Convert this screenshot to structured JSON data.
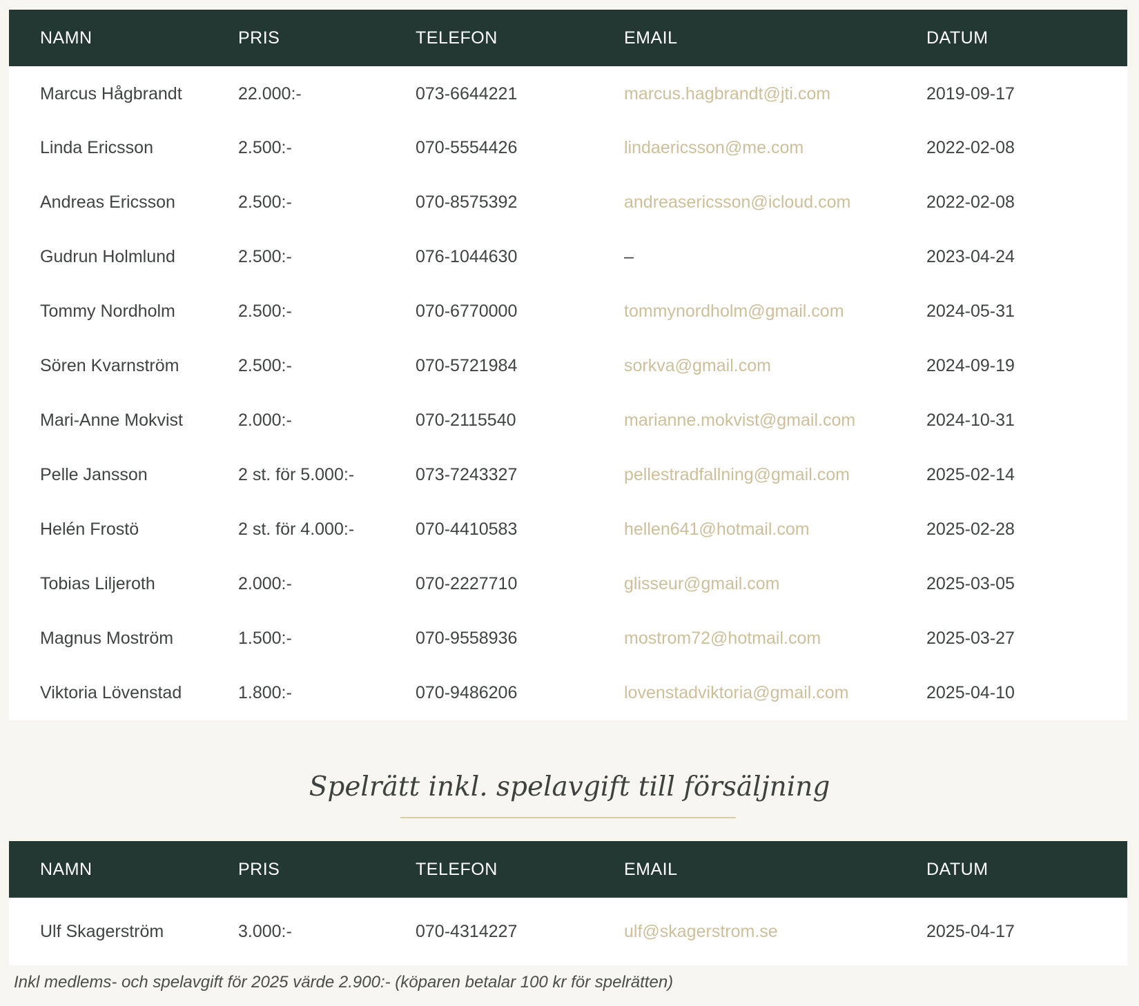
{
  "columns": [
    "NAMN",
    "PRIS",
    "TELEFON",
    "EMAIL",
    "DATUM"
  ],
  "table1": {
    "rows": [
      {
        "name": "Marcus Hågbrandt",
        "price": "22.000:-",
        "phone": "073-6644221",
        "email": "marcus.hagbrandt@jti.com",
        "date": "2019-09-17"
      },
      {
        "name": "Linda Ericsson",
        "price": "2.500:-",
        "phone": "070-5554426",
        "email": "lindaericsson@me.com",
        "date": "2022-02-08"
      },
      {
        "name": "Andreas Ericsson",
        "price": "2.500:-",
        "phone": "070-8575392",
        "email": "andreasericsson@icloud.com",
        "date": "2022-02-08"
      },
      {
        "name": "Gudrun Holmlund",
        "price": "2.500:-",
        "phone": "076-1044630",
        "email": "–",
        "date": "2023-04-24"
      },
      {
        "name": "Tommy Nordholm",
        "price": "2.500:-",
        "phone": "070-6770000",
        "email": "tommynordholm@gmail.com",
        "date": "2024-05-31"
      },
      {
        "name": "Sören Kvarnström",
        "price": "2.500:-",
        "phone": "070-5721984",
        "email": "sorkva@gmail.com",
        "date": "2024-09-19"
      },
      {
        "name": "Mari-Anne Mokvist",
        "price": "2.000:-",
        "phone": "070-2115540",
        "email": "marianne.mokvist@gmail.com",
        "date": "2024-10-31"
      },
      {
        "name": "Pelle Jansson",
        "price": "2 st. för 5.000:-",
        "phone": "073-7243327",
        "email": "pellestradfallning@gmail.com",
        "date": "2025-02-14"
      },
      {
        "name": "Helén Frostö",
        "price": "2 st. för 4.000:-",
        "phone": "070-4410583",
        "email": "hellen641@hotmail.com",
        "date": "2025-02-28"
      },
      {
        "name": "Tobias Liljeroth",
        "price": "2.000:-",
        "phone": "070-2227710",
        "email": "glisseur@gmail.com",
        "date": "2025-03-05"
      },
      {
        "name": "Magnus Moström",
        "price": "1.500:-",
        "phone": "070-9558936",
        "email": "mostrom72@hotmail.com",
        "date": "2025-03-27"
      },
      {
        "name": "Viktoria Lövenstad",
        "price": "1.800:-",
        "phone": "070-9486206",
        "email": "lovenstadviktoria@gmail.com",
        "date": "2025-04-10"
      }
    ]
  },
  "section2": {
    "title": "Spelrätt inkl. spelavgift till försäljning",
    "rows": [
      {
        "name": "Ulf Skagerström",
        "price": "3.000:-",
        "phone": "070-4314227",
        "email": "ulf@skagerstrom.se",
        "date": "2025-04-17"
      }
    ],
    "footnote": "Inkl medlems- och spelavgift för 2025 värde 2.900:- (köparen betalar 100 kr för spelrätten)"
  },
  "colors": {
    "header_bg": "#233833",
    "email_link": "#cdbf99",
    "page_bg": "#f8f6f1"
  }
}
